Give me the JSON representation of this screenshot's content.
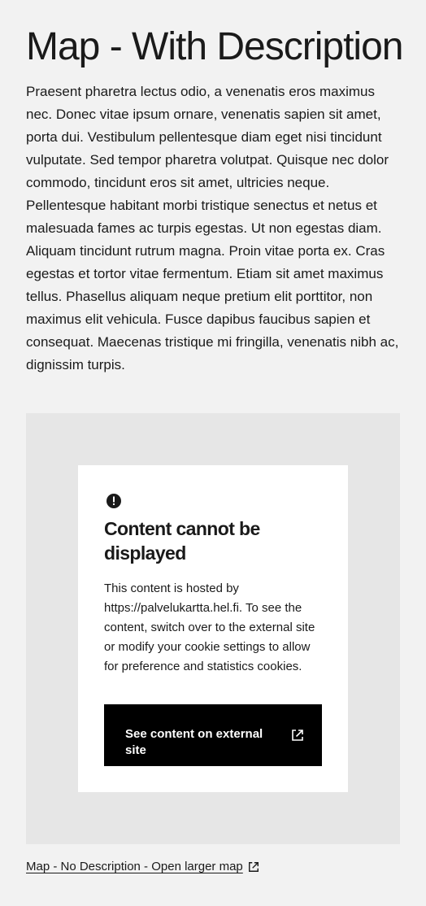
{
  "page": {
    "title": "Map - With Description",
    "description": "Praesent pharetra lectus odio, a venenatis eros maximus nec. Donec vitae ipsum ornare, venenatis sapien sit amet, porta dui. Vestibulum pellentesque diam eget nisi tincidunt vulputate. Sed tempor pharetra volutpat. Quisque nec dolor commodo, tincidunt eros sit amet, ultricies neque. Pellentesque habitant morbi tristique senectus et netus et malesuada fames ac turpis egestas. Ut non egestas diam. Aliquam tincidunt rutrum magna. Proin vitae porta ex. Cras egestas et tortor vitae fermentum. Etiam sit amet maximus tellus. Phasellus aliquam neque pretium elit porttitor, non maximus elit vehicula. Fusce dapibus faucibus sapien et consequat. Maecenas tristique mi fringilla, venenatis nibh ac, dignissim turpis."
  },
  "map_notice": {
    "icon": "alert-circle-icon",
    "title": "Content cannot be displayed",
    "text": "This content is hosted by https://palvelukartta.hel.fi. To see the content, switch over to the external site or modify your cookie settings to allow for preference and statistics cookies.",
    "button_label": "See content on external site",
    "button_icon": "external-link-icon"
  },
  "map_link": {
    "label": "Map - No Description - Open larger map",
    "icon": "external-link-icon"
  },
  "colors": {
    "page_background": "#f2f2f2",
    "map_background": "#e6e6e6",
    "notice_background": "#ffffff",
    "button_background": "#000000",
    "text": "#1a1a1a"
  }
}
